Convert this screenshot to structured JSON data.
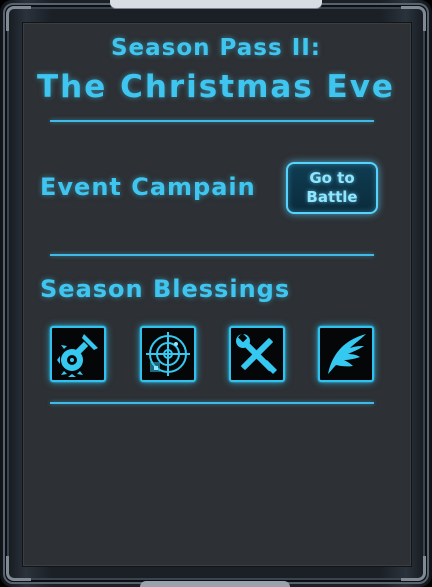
{
  "header": {
    "title_line1": "Season Pass II:",
    "title_line2": "The Christmas Eve"
  },
  "event": {
    "label": "Event Campain",
    "button_line1": "Go to",
    "button_line2": "Battle"
  },
  "blessings": {
    "label": "Season Blessings",
    "items": [
      {
        "icon": "saw-blade-sword-icon"
      },
      {
        "icon": "radar-target-icon"
      },
      {
        "icon": "wrench-screwdriver-icon"
      },
      {
        "icon": "wing-icon"
      }
    ]
  },
  "colors": {
    "accent": "#3fc6f0",
    "panel_background": "#2d3034",
    "frame": "#1b2027"
  }
}
